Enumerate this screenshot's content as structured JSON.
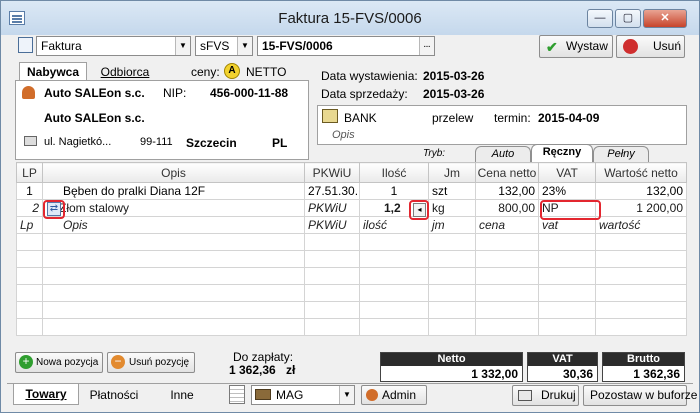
{
  "window": {
    "title": "Faktura 15-FVS/0006",
    "controls": {
      "minimize": "—",
      "maximize": "▢",
      "close": "✕"
    }
  },
  "toolbar": {
    "doc_type": "Faktura",
    "series": "sFVS",
    "number": "15-FVS/0006",
    "issue_button": "Wystaw",
    "delete_button": "Usuń"
  },
  "buyer_tabs": [
    "Nabywca",
    "Odbiorca"
  ],
  "prices": {
    "label": "ceny:",
    "badge": "A",
    "mode": "NETTO"
  },
  "buyer": {
    "name": "Auto SALEon s.c.",
    "nip_label": "NIP:",
    "nip": "456-000-11-88",
    "name2": "Auto SALEon s.c.",
    "street": "ul. Nagietkó...",
    "postcode": "99-111",
    "city": "Szczecin",
    "country": "PL"
  },
  "dates": {
    "issue_label": "Data wystawienia:",
    "issue": "2015-03-26",
    "sale_label": "Data sprzedaży:",
    "sale": "2015-03-26"
  },
  "payment": {
    "bank": "BANK",
    "method": "przelew",
    "term_label": "termin:",
    "term": "2015-04-09",
    "desc_placeholder": "Opis"
  },
  "mode": {
    "label": "Tryb:",
    "tabs": [
      "Auto",
      "Ręczny",
      "Pełny"
    ],
    "selected": "Ręczny"
  },
  "table": {
    "headers": [
      "LP",
      "Opis",
      "PKWiU",
      "Ilość",
      "Jm",
      "Cena netto",
      "VAT",
      "Wartość netto"
    ],
    "rows": [
      [
        "1",
        "Bęben do pralki Diana 12F",
        "27.51.30...",
        "1",
        "szt",
        "132,00",
        "23%",
        "132,00"
      ],
      [
        "2",
        "Złom stalowy",
        "PKWiU",
        "1,2",
        "kg",
        "800,00",
        "NP",
        "1 200,00"
      ]
    ],
    "hint_row": [
      "Lp",
      "Opis",
      "PKWiU",
      "ilość",
      "jm",
      "cena",
      "vat",
      "wartość"
    ]
  },
  "buttons": {
    "add_position": "Nowa pozycja",
    "remove_position": "Usuń pozycję"
  },
  "to_pay": {
    "label": "Do zapłaty:",
    "value": "1 362,36",
    "currency": "zł"
  },
  "totals": {
    "netto_label": "Netto",
    "netto": "1 332,00",
    "vat_label": "VAT",
    "vat": "30,36",
    "brutto_label": "Brutto",
    "brutto": "1 362,36"
  },
  "bottom_tabs": [
    "Towary",
    "Płatności",
    "Inne"
  ],
  "warehouse": "MAG",
  "user": "Admin",
  "print_button": "Drukuj",
  "buffer_button": "Pozostaw w buforze",
  "colors": {
    "highlight": "#e3262f",
    "accent_green": "#2f9e2f",
    "delete_red": "#cf2e2e",
    "badge_yellow": "#f2d22e"
  }
}
